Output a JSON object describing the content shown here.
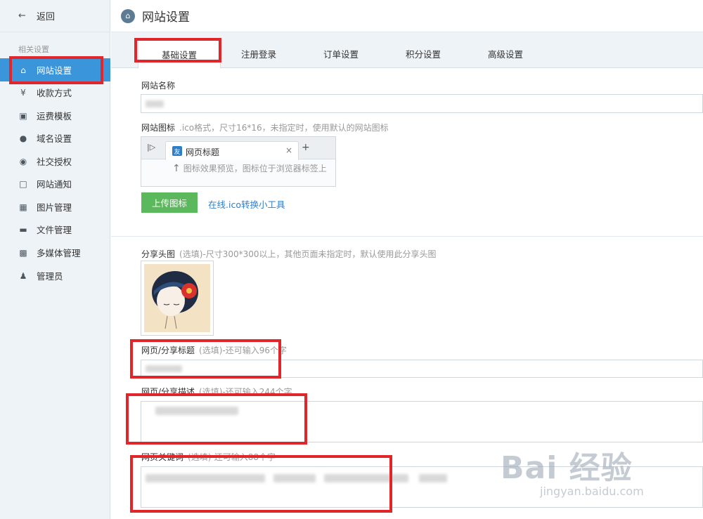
{
  "sidebar": {
    "back_label": "返回",
    "section_label": "相关设置",
    "items": [
      {
        "label": "网站设置",
        "icon": "home-icon",
        "active": true
      },
      {
        "label": "收款方式",
        "icon": "yen-shield-icon"
      },
      {
        "label": "运费模板",
        "icon": "truck-icon"
      },
      {
        "label": "域名设置",
        "icon": "globe-icon"
      },
      {
        "label": "社交授权",
        "icon": "target-icon"
      },
      {
        "label": "网站通知",
        "icon": "message-icon"
      },
      {
        "label": "图片管理",
        "icon": "image-icon"
      },
      {
        "label": "文件管理",
        "icon": "folder-icon"
      },
      {
        "label": "多媒体管理",
        "icon": "media-icon"
      },
      {
        "label": "管理员",
        "icon": "user-icon"
      }
    ]
  },
  "header": {
    "title": "网站设置"
  },
  "tabs": [
    {
      "label": "基础设置",
      "active": true
    },
    {
      "label": "注册登录"
    },
    {
      "label": "订单设置"
    },
    {
      "label": "积分设置"
    },
    {
      "label": "高级设置"
    }
  ],
  "form": {
    "site_name": {
      "label": "网站名称"
    },
    "site_icon": {
      "label": "网站图标",
      "hint": ".ico格式，尺寸16*16，未指定时，使用默认的网站图标",
      "preview_tab_title": "网页标题",
      "preview_hint": "图标效果预览，图标位于浏览器标签上",
      "upload_button": "上传图标",
      "convert_link": "在线.ico转换小工具"
    },
    "share_image": {
      "label": "分享头图",
      "hint": "(选填)-尺寸300*300以上，其他页面未指定时，默认使用此分享头图"
    },
    "share_title": {
      "label": "网页/分享标题",
      "hint": "(选填)-还可输入96个字"
    },
    "share_desc": {
      "label": "网页/分享描述",
      "hint": "(选填)-还可输入244个字"
    },
    "keywords": {
      "label": "网页关键词",
      "hint": "(选填)-还可输入88个字"
    }
  },
  "watermark": {
    "main": "Bai 经验",
    "sub": "jingyan.baidu.com"
  },
  "colors": {
    "accent": "#3a95db",
    "upload_button": "#5cb85c",
    "highlight_box": "#e0262b",
    "sidebar_bg": "#eef3f7"
  }
}
